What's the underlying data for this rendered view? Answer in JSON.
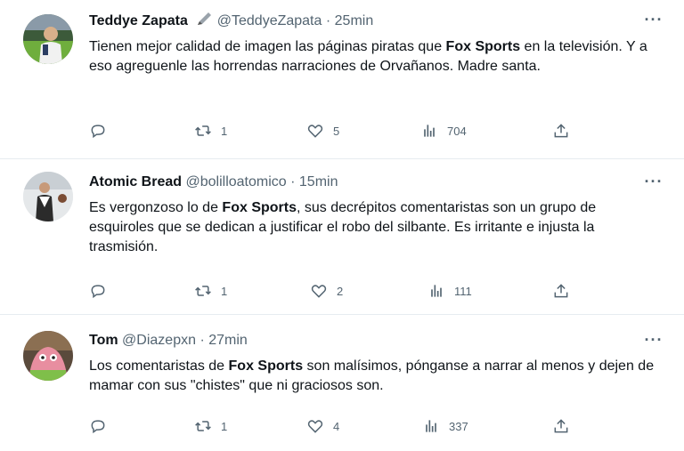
{
  "tweets": [
    {
      "name": "Teddye Zapata",
      "badge": "pen-icon",
      "handle": "@TeddyeZapata",
      "separator": "·",
      "time": "25min",
      "more": "···",
      "text_parts": [
        "Tienen mejor calidad de imagen las páginas piratas que ",
        "Fox Sports",
        " en la televisión. Y a eso agreguenle las horrendas narraciones de Orvañanos. Madre santa."
      ],
      "replies": "",
      "retweets": "1",
      "likes": "5",
      "views": "704"
    },
    {
      "name": "Atomic Bread",
      "handle": "@bolilloatomico",
      "separator": "·",
      "time": "15min",
      "more": "···",
      "text_parts": [
        "Es vergonzoso lo de ",
        "Fox Sports",
        ", sus decrépitos comentaristas son un grupo de esquiroles que se dedican a justificar el robo del silbante.  Es irritante e injusta la trasmisión."
      ],
      "replies": "",
      "retweets": "1",
      "likes": "2",
      "views": "111"
    },
    {
      "name": "Tom",
      "handle": "@Diazepxn",
      "separator": "·",
      "time": "27min",
      "more": "···",
      "text_parts": [
        "Los comentaristas de ",
        "Fox Sports",
        " son malísimos, pónganse a narrar al menos y dejen de mamar con sus \"chistes\" que ni graciosos son."
      ],
      "replies": "",
      "retweets": "1",
      "likes": "4",
      "views": "337"
    }
  ],
  "colors": {
    "text": "#0f1419",
    "secondary": "#536471",
    "divider": "#e6ecf0"
  }
}
